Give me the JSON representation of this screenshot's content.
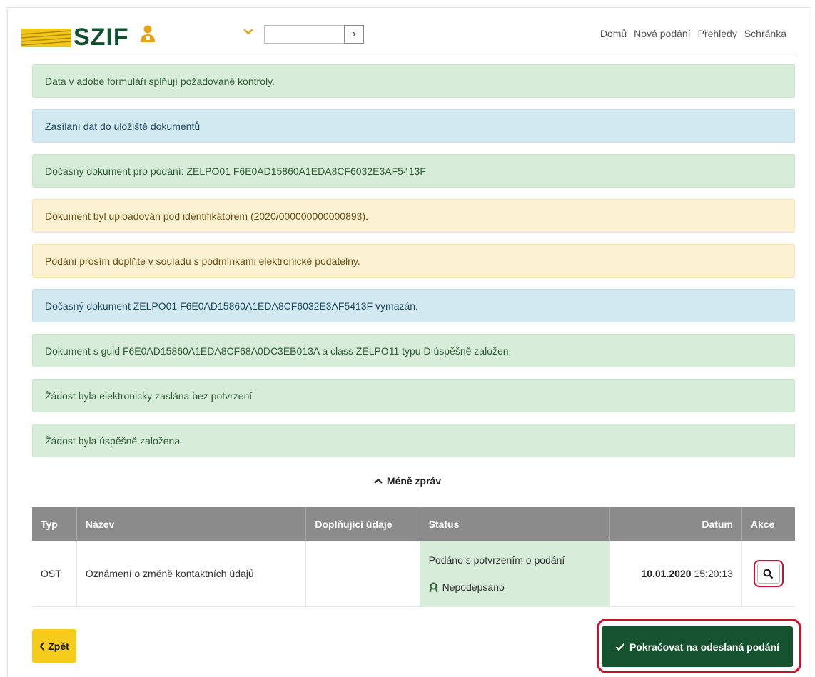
{
  "header": {
    "logo_text": "SZIF",
    "search_value": "",
    "go_label": "›",
    "nav": [
      "Domů",
      "Nová podání",
      "Přehledy",
      "Schránka"
    ]
  },
  "messages": [
    {
      "type": "success",
      "text": "Data v adobe formuláři splňují požadované kontroly."
    },
    {
      "type": "info",
      "text": "Zasílání dat do úložiště dokumentů"
    },
    {
      "type": "success",
      "text": "Dočasný dokument pro podání: ZELPO01 F6E0AD15860A1EDA8CF6032E3AF5413F"
    },
    {
      "type": "warning",
      "text": "Dokument byl uploadován pod identifikátorem (2020/000000000000893)."
    },
    {
      "type": "warning",
      "text": "Podání prosím doplňte v souladu s podmínkami elektronické podatelny."
    },
    {
      "type": "info",
      "text": "Dočasný dokument ZELPO01 F6E0AD15860A1EDA8CF6032E3AF5413F vymazán."
    },
    {
      "type": "success",
      "text": "Dokument s guid F6E0AD15860A1EDA8CF68A0DC3EB013A a class ZELPO11 typu D úspěšně založen."
    },
    {
      "type": "success",
      "text": "Žádost byla elektronicky zaslána bez potvrzení"
    },
    {
      "type": "success",
      "text": "Žádost byla úspěšně založena"
    }
  ],
  "less_messages_label": "Méně zpráv",
  "table": {
    "headers": {
      "type": "Typ",
      "name": "Název",
      "extra": "Doplňující údaje",
      "status": "Status",
      "date": "Datum",
      "action": "Akce"
    },
    "rows": [
      {
        "type": "OST",
        "name": "Oznámení o změně kontaktních údajů",
        "extra": "",
        "status_main": "Podáno s potvrzením o podání",
        "status_sign": "Nepodepsáno",
        "date": "10.01.2020",
        "time": "15:20:13"
      }
    ]
  },
  "buttons": {
    "back": "Zpět",
    "continue": "Pokračovat na odeslaná podání"
  },
  "colors": {
    "brand_green": "#12512f",
    "brand_yellow": "#f5cc1c",
    "highlight_red": "#c8102e"
  }
}
